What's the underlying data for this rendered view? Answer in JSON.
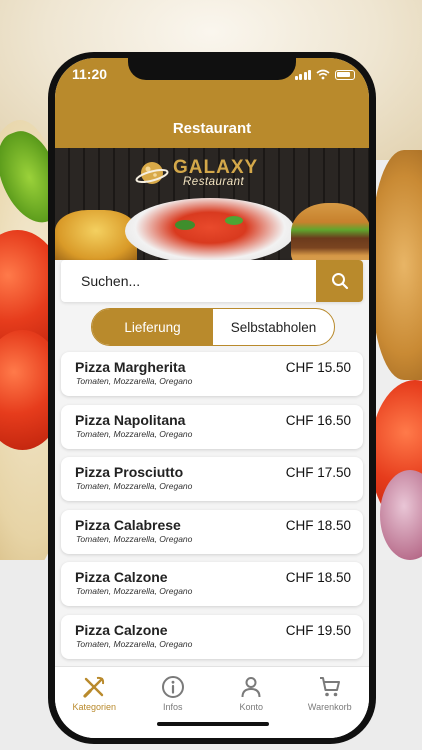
{
  "status": {
    "time": "11:20"
  },
  "header": {
    "title": "Restaurant"
  },
  "brand": {
    "name": "GALAXY",
    "subtitle": "Restaurant"
  },
  "search": {
    "placeholder": "Suchen..."
  },
  "order_mode": {
    "options": [
      "Lieferung",
      "Selbstabholen"
    ],
    "selected": "Lieferung"
  },
  "menu": {
    "items": [
      {
        "name": "Pizza Margherita",
        "description": "Tomaten, Mozzarella, Oregano",
        "price": "CHF 15.50"
      },
      {
        "name": "Pizza Napolitana",
        "description": "Tomaten, Mozzarella, Oregano",
        "price": "CHF 16.50"
      },
      {
        "name": "Pizza Prosciutto",
        "description": "Tomaten, Mozzarella, Oregano",
        "price": "CHF 17.50"
      },
      {
        "name": "Pizza Calabrese",
        "description": "Tomaten, Mozzarella, Oregano",
        "price": "CHF 18.50"
      },
      {
        "name": "Pizza Calzone",
        "description": "Tomaten, Mozzarella, Oregano",
        "price": "CHF 18.50"
      },
      {
        "name": "Pizza Calzone",
        "description": "Tomaten, Mozzarella, Oregano",
        "price": "CHF 19.50"
      }
    ]
  },
  "tabbar": {
    "tabs": [
      {
        "label": "Kategorien",
        "icon": "utensils-icon"
      },
      {
        "label": "Infos",
        "icon": "info-icon"
      },
      {
        "label": "Konto",
        "icon": "user-icon"
      },
      {
        "label": "Warenkorb",
        "icon": "cart-icon"
      }
    ],
    "active": "Kategorien"
  },
  "colors": {
    "accent": "#b98a2c",
    "background": "#f4f4f4"
  }
}
